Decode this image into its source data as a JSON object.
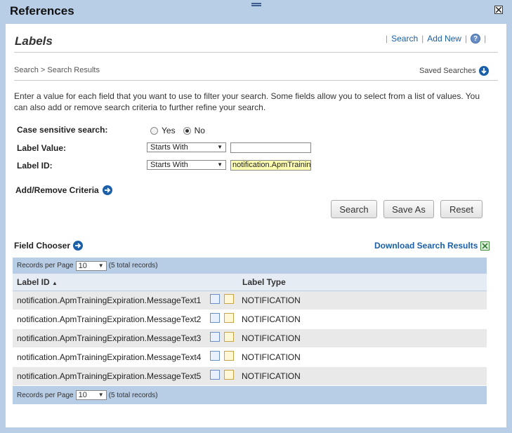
{
  "window": {
    "title": "References"
  },
  "header": {
    "title": "Labels",
    "links": {
      "search": "Search",
      "add_new": "Add New",
      "help": "?"
    },
    "separator": "|"
  },
  "breadcrumb": {
    "text": "Search > Search Results"
  },
  "saved_searches": {
    "label": "Saved Searches"
  },
  "intro_text": "Enter a value for each field that you want to use to filter your search. Some fields allow you to select from a list of values. You can also add or remove search criteria to further refine your search.",
  "form": {
    "case_sensitive": {
      "label": "Case sensitive search:",
      "yes": "Yes",
      "no": "No",
      "selected": "No"
    },
    "label_value": {
      "label": "Label Value:",
      "operator": "Starts With",
      "value": ""
    },
    "label_id": {
      "label": "Label ID:",
      "operator": "Starts With",
      "value": "notification.ApmTraining"
    },
    "add_remove": "Add/Remove Criteria",
    "buttons": {
      "search": "Search",
      "save_as": "Save As",
      "reset": "Reset"
    }
  },
  "field_chooser": "Field Chooser",
  "download": "Download Search Results",
  "grid": {
    "records_per_page_label": "Records per Page",
    "records_per_page": "10",
    "total": "(5 total records)",
    "columns": {
      "label_id": "Label ID",
      "sort_indicator": "▲",
      "label_type": "Label Type"
    },
    "rows": [
      {
        "label_id": "notification.ApmTrainingExpiration.MessageText1",
        "label_type": "NOTIFICATION"
      },
      {
        "label_id": "notification.ApmTrainingExpiration.MessageText2",
        "label_type": "NOTIFICATION"
      },
      {
        "label_id": "notification.ApmTrainingExpiration.MessageText3",
        "label_type": "NOTIFICATION"
      },
      {
        "label_id": "notification.ApmTrainingExpiration.MessageText4",
        "label_type": "NOTIFICATION"
      },
      {
        "label_id": "notification.ApmTrainingExpiration.MessageText5",
        "label_type": "NOTIFICATION"
      }
    ]
  },
  "colors": {
    "accent": "#1a5fa8",
    "frame": "#b8cde6",
    "highlight": "#ffffb0"
  }
}
